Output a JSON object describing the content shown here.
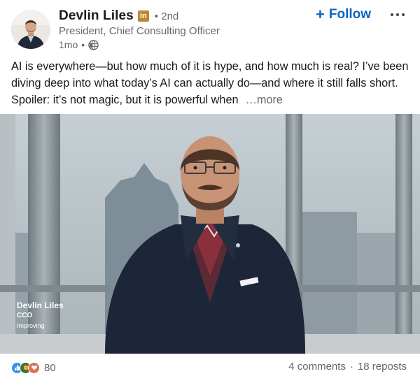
{
  "author": {
    "name": "Devlin Liles",
    "badge_text": "in",
    "degree": "2nd",
    "headline": "President, Chief Consulting Officer",
    "time": "1mo",
    "dot": "•",
    "visibility_icon": "globe-icon"
  },
  "actions": {
    "follow_label": "Follow",
    "follow_plus": "+",
    "more_icon": "more-horizontal-icon"
  },
  "post": {
    "text": "AI is everywhere—but how much of it is hype, and how much is real? I’ve been diving deep into what today’s AI can actually do—and where it still falls short. Spoiler: it’s not magic, but it is powerful when",
    "see_more": "…more"
  },
  "video": {
    "overlay_name": "Devlin Liles",
    "overlay_title": "CCO",
    "overlay_org": "Improving"
  },
  "social": {
    "reaction_icons": [
      "like-icon",
      "celebrate-icon",
      "love-icon"
    ],
    "reaction_count": "80",
    "comments": "4 comments",
    "separator": "·",
    "reposts": "18 reposts"
  },
  "colors": {
    "accent": "#0a66c2",
    "muted_text": "#666666",
    "primary_text": "#191919",
    "premium_badge": "#b68a2d"
  }
}
